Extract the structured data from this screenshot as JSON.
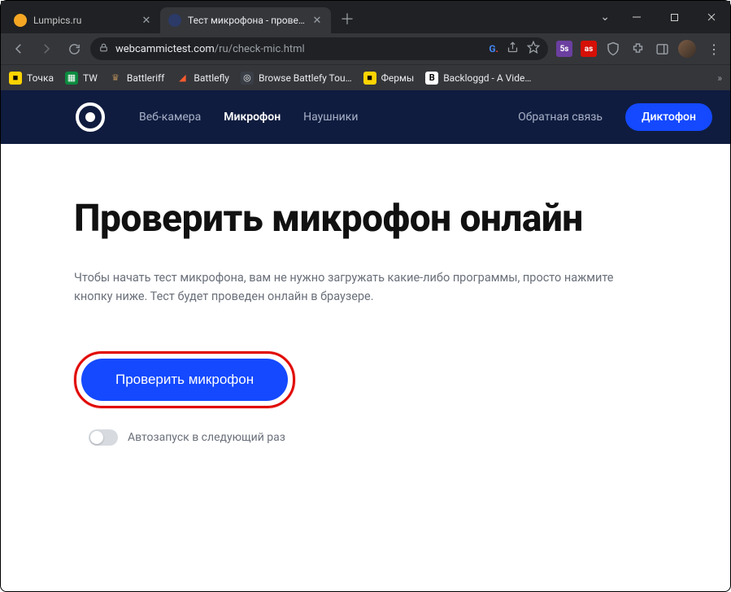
{
  "window": {
    "tabs": [
      {
        "title": "Lumpics.ru",
        "active": false,
        "favicon_color": "#f5a623"
      },
      {
        "title": "Тест микрофона - проверка ми",
        "active": true,
        "favicon_color": "#2b3a67"
      }
    ]
  },
  "addressbar": {
    "host": "webcammictest.com",
    "path": "/ru/check-mic.html"
  },
  "bookmarks": [
    {
      "label": "Точка",
      "icon_bg": "#ffd400",
      "icon_fg": "#000",
      "glyph": "■"
    },
    {
      "label": "TW",
      "icon_bg": "#0b8a3e",
      "icon_fg": "#fff",
      "glyph": "▦"
    },
    {
      "label": "Battleriff",
      "icon_bg": "#000",
      "icon_fg": "#b08b57",
      "glyph": "♛"
    },
    {
      "label": "Battlefly",
      "icon_bg": "#000",
      "icon_fg": "#ff5b2e",
      "glyph": "◢"
    },
    {
      "label": "Browse Battlefy Tou…",
      "icon_bg": "#3a3f47",
      "icon_fg": "#eee",
      "glyph": "◎"
    },
    {
      "label": "Фермы",
      "icon_bg": "#ffd400",
      "icon_fg": "#000",
      "glyph": "■"
    },
    {
      "label": "Backloggd - A Vide…",
      "icon_bg": "#fff",
      "icon_fg": "#000",
      "glyph": "B"
    }
  ],
  "sitenav": {
    "items": [
      {
        "label": "Веб-камера",
        "active": false
      },
      {
        "label": "Микрофон",
        "active": true
      },
      {
        "label": "Наушники",
        "active": false
      }
    ],
    "feedback": "Обратная связь",
    "recorder": "Диктофон"
  },
  "content": {
    "heading": "Проверить микрофон онлайн",
    "lead": "Чтобы начать тест микрофона, вам не нужно загружать какие-либо программы, просто нажмите кнопку ниже. Тест будет проведен онлайн в браузере.",
    "cta": "Проверить микрофон",
    "toggle_label": "Автозапуск в следующий раз"
  }
}
